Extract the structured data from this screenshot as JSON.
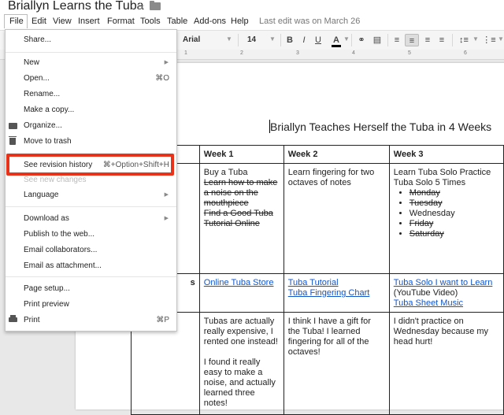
{
  "doc": {
    "title": "Briallyn Learns the Tuba",
    "star_icon": "star-icon",
    "folder_icon": "folder-icon"
  },
  "menubar": {
    "items": [
      "File",
      "Edit",
      "View",
      "Insert",
      "Format",
      "Tools",
      "Table",
      "Add-ons",
      "Help"
    ],
    "last_edit": "Last edit was on March 26"
  },
  "toolbar": {
    "font": "Arial",
    "size": "14",
    "bold": "B",
    "italic": "I",
    "underline": "U",
    "text_color": "A"
  },
  "ruler": {
    "marks": [
      "1",
      "2",
      "3",
      "4",
      "5",
      "6"
    ]
  },
  "file_menu": {
    "share": "Share...",
    "new": "New",
    "open": "Open...",
    "open_shortcut": "⌘O",
    "rename": "Rename...",
    "make_copy": "Make a copy...",
    "organize": "Organize...",
    "move_to_trash": "Move to trash",
    "see_revision_history": "See revision history",
    "revision_shortcut": "⌘+Option+Shift+H",
    "see_new_changes": "See new changes",
    "language": "Language",
    "download_as": "Download as",
    "publish": "Publish to the web...",
    "email_collaborators": "Email collaborators...",
    "email_attachment": "Email as attachment...",
    "page_setup": "Page setup...",
    "print_preview": "Print preview",
    "print": "Print",
    "print_shortcut": "⌘P"
  },
  "document": {
    "heading": "Briallyn Teaches Herself the Tuba in 4 Weeks",
    "table": {
      "headers": [
        "Week 1",
        "Week 2",
        "Week 3"
      ],
      "row1_label": "",
      "week1_tasks": {
        "plain": "Buy a Tuba",
        "struck": [
          "Learn how to make a noise on the mouthpiece",
          "Find a Good Tuba Tutorial Online"
        ]
      },
      "week2_tasks": "Learn fingering for two octaves of notes",
      "week3_tasks": {
        "intro": "Learn Tuba Solo Practice Tuba Solo 5 Times",
        "days": [
          {
            "day": "Monday",
            "done": true
          },
          {
            "day": "Tuesday",
            "done": true
          },
          {
            "day": "Wednesday",
            "done": false
          },
          {
            "day": "Friday",
            "done": true
          },
          {
            "day": "Saturday",
            "done": true
          }
        ]
      },
      "row2_label_fragment": "s",
      "week1_links": [
        "Online Tuba Store"
      ],
      "week2_links": [
        "Tuba Tutorial",
        "Tuba Fingering Chart"
      ],
      "week3_link1": "Tuba Solo I want to Learn",
      "week3_link1_suffix": " (YouTube Video)",
      "week3_link2": "Tuba Sheet Music",
      "week1_notes_1": "Tubas are actually really expensive, I rented one instead!",
      "week1_notes_2": "I found it really easy to make a noise, and actually learned three notes!",
      "week2_notes": "I think I have a gift for the Tuba! I learned fingering for all of the octaves!",
      "week3_notes": "I didn't practice on Wednesday because my head hurt!"
    }
  },
  "colors": {
    "highlight": "#e8321a",
    "link": "#1155cc"
  }
}
